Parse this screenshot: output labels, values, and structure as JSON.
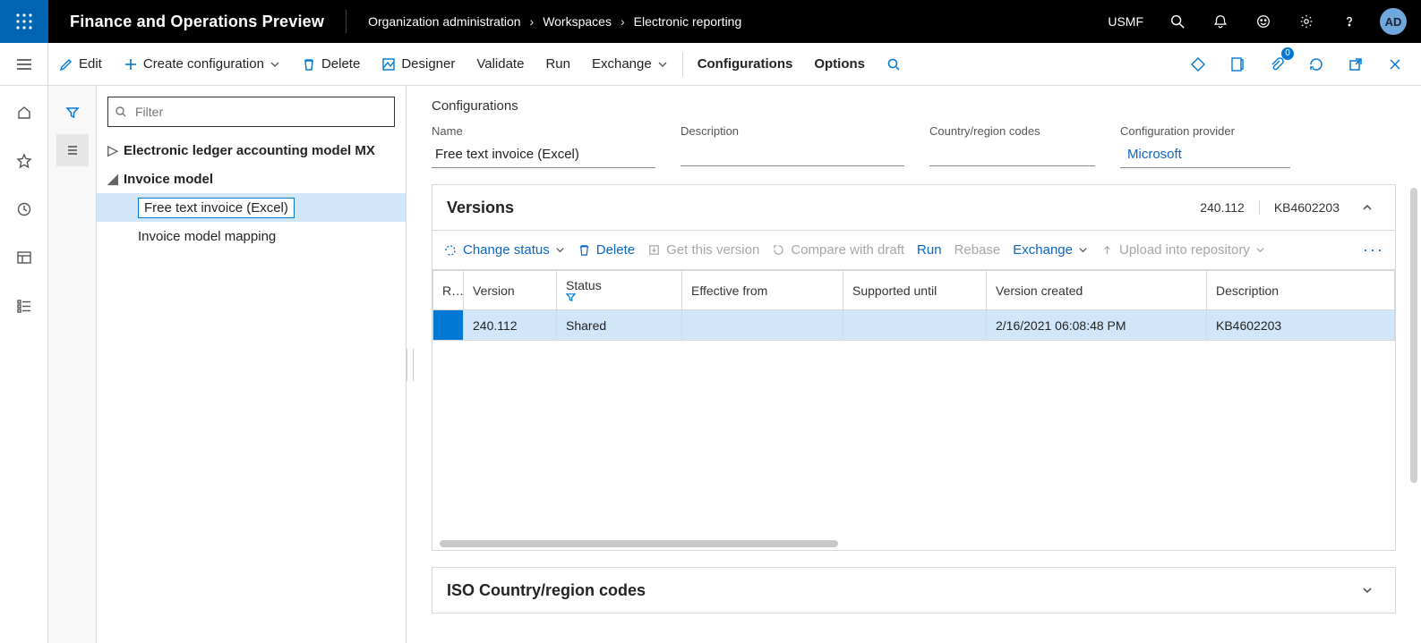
{
  "app_title": "Finance and Operations Preview",
  "breadcrumbs": [
    "Organization administration",
    "Workspaces",
    "Electronic reporting"
  ],
  "entity": "USMF",
  "avatar": "AD",
  "actionbar": {
    "edit": "Edit",
    "create": "Create configuration",
    "delete": "Delete",
    "designer": "Designer",
    "validate": "Validate",
    "run": "Run",
    "exchange": "Exchange",
    "configurations": "Configurations",
    "options": "Options",
    "attachments_badge": "0"
  },
  "filter": {
    "placeholder": "Filter"
  },
  "tree": {
    "nodes": [
      {
        "label": "Electronic ledger accounting model MX",
        "expanded": false,
        "level": 1,
        "bold": true
      },
      {
        "label": "Invoice model",
        "expanded": true,
        "level": 1,
        "bold": true
      },
      {
        "label": "Free text invoice (Excel)",
        "level": 2,
        "selected": true
      },
      {
        "label": "Invoice model mapping",
        "level": 2
      }
    ]
  },
  "detail": {
    "section_label": "Configurations",
    "fields": {
      "name": {
        "label": "Name",
        "value": "Free text invoice (Excel)"
      },
      "description": {
        "label": "Description",
        "value": ""
      },
      "country": {
        "label": "Country/region codes",
        "value": ""
      },
      "provider": {
        "label": "Configuration provider",
        "value": "Microsoft"
      }
    }
  },
  "versions": {
    "title": "Versions",
    "summary": {
      "version": "240.112",
      "kb": "KB4602203"
    },
    "toolbar": {
      "change_status": "Change status",
      "delete": "Delete",
      "get_version": "Get this version",
      "compare": "Compare with draft",
      "run": "Run",
      "rebase": "Rebase",
      "exchange": "Exchange",
      "upload": "Upload into repository"
    },
    "columns": [
      "R...",
      "Version",
      "Status",
      "Effective from",
      "Supported until",
      "Version created",
      "Description"
    ],
    "rows": [
      {
        "r": "",
        "version": "240.112",
        "status": "Shared",
        "effective": "",
        "supported": "",
        "created": "2/16/2021 06:08:48 PM",
        "description": "KB4602203"
      }
    ]
  },
  "iso": {
    "title": "ISO Country/region codes"
  }
}
